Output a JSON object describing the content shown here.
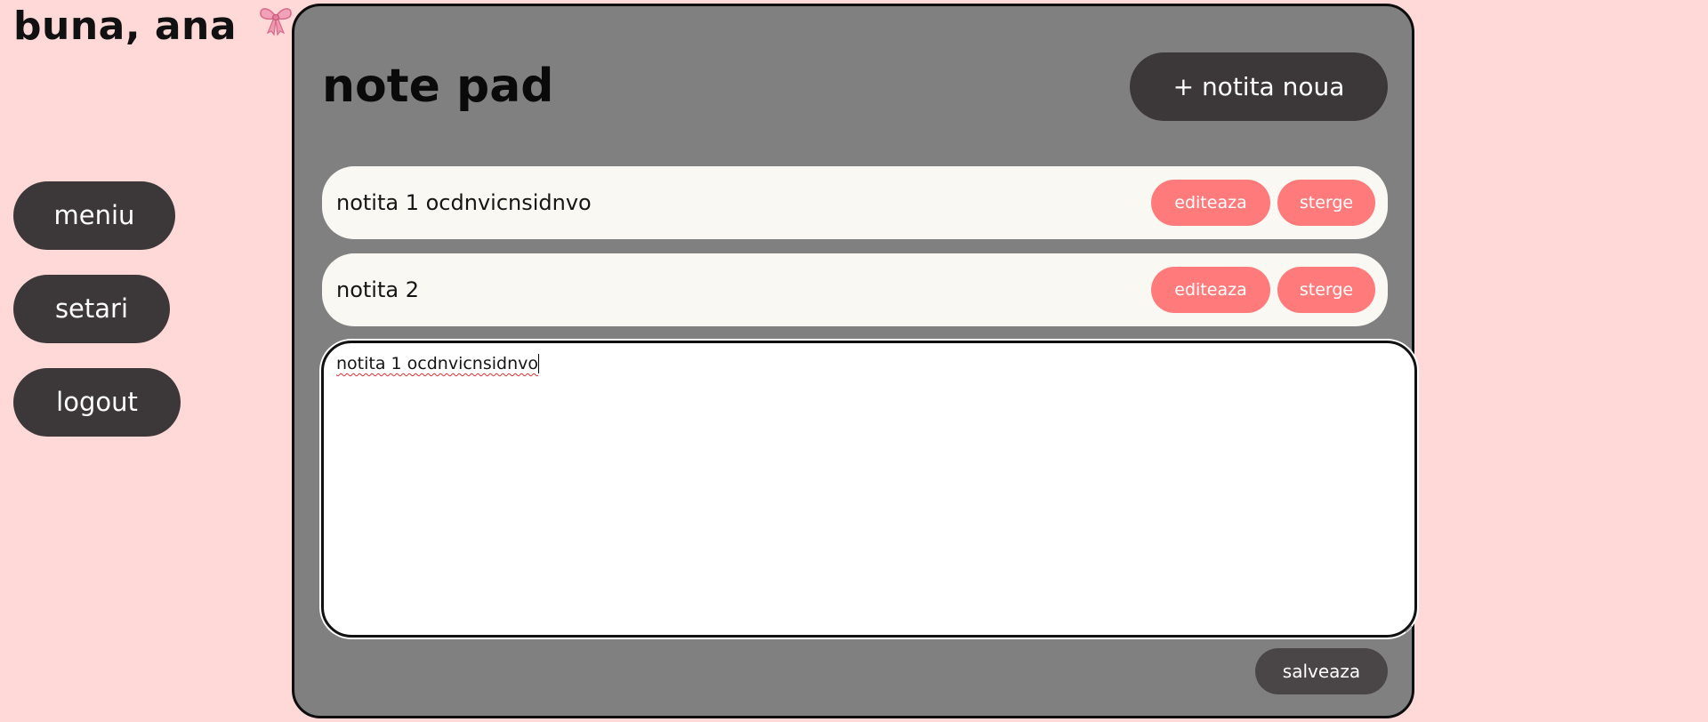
{
  "greeting": {
    "text": "buna, ana",
    "icon": "ribbon-bow-icon"
  },
  "sidebar": {
    "items": [
      {
        "label": "meniu"
      },
      {
        "label": "setari"
      },
      {
        "label": "logout"
      }
    ]
  },
  "notepad": {
    "title": "note pad",
    "new_note_label": "+ notita noua",
    "notes": [
      {
        "text": "notita 1 ocdnvicnsidnvo",
        "edit_label": "editeaza",
        "delete_label": "sterge"
      },
      {
        "text": "notita 2",
        "edit_label": "editeaza",
        "delete_label": "sterge"
      }
    ],
    "editor": {
      "value": "notita 1 ocdnvicnsidnvo"
    },
    "save_label": "salveaza"
  },
  "colors": {
    "background": "#ffd8d8",
    "panel": "#808080",
    "dark_button": "#3c3839",
    "accent_button": "#ff7b7b",
    "note_row": "#faf8f2"
  }
}
